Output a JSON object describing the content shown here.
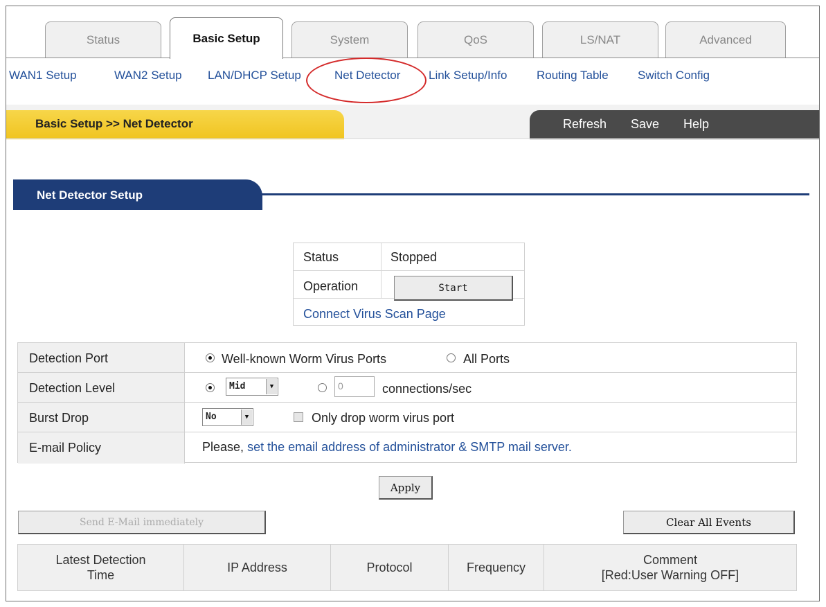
{
  "main_tabs": [
    "Status",
    "Basic Setup",
    "System",
    "QoS",
    "LS/NAT",
    "Advanced"
  ],
  "active_tab": "Basic Setup",
  "sub_nav": [
    "WAN1 Setup",
    "WAN2 Setup",
    "LAN/DHCP Setup",
    "Net Detector",
    "Link Setup/Info",
    "Routing Table",
    "Switch Config"
  ],
  "highlighted_item": "Net Detector",
  "header": {
    "breadcrumb": "Basic Setup >> Net Detector",
    "actions": [
      "Refresh",
      "Save",
      "Help"
    ]
  },
  "section_title": "Net Detector Setup",
  "status_box": {
    "status_label": "Status",
    "status_value": "Stopped",
    "operation_label": "Operation",
    "start_button": "Start",
    "virus_link": "Connect Virus Scan Page"
  },
  "settings": {
    "detection_port_label": "Detection Port",
    "port_option_wellknown": "Well-known Worm Virus Ports",
    "port_option_all": "All Ports",
    "port_selected": "Well-known Worm Virus Ports",
    "detection_level_label": "Detection Level",
    "level_select_value": "Mid",
    "level_custom_value": "0",
    "level_unit": "connections/sec",
    "level_selected": "preset",
    "burst_drop_label": "Burst Drop",
    "burst_select_value": "No",
    "only_drop_label": "Only drop worm virus port",
    "only_drop_checked": false,
    "email_policy_label": "E-mail Policy",
    "email_prefix": "Please,",
    "email_link": "set the email address of administrator & SMTP mail server."
  },
  "buttons": {
    "apply": "Apply",
    "send_email": "Send E-Mail immediately",
    "clear_events": "Clear All Events"
  },
  "events_table": {
    "columns": [
      "Latest Detection\nTime",
      "IP Address",
      "Protocol",
      "Frequency",
      "Comment\n[Red:User Warning OFF]"
    ],
    "rows": []
  },
  "colors": {
    "link_blue": "#23509a",
    "header_yellow": "#f0c420",
    "section_navy": "#1e3d78",
    "highlight_red": "#d42a2a"
  }
}
